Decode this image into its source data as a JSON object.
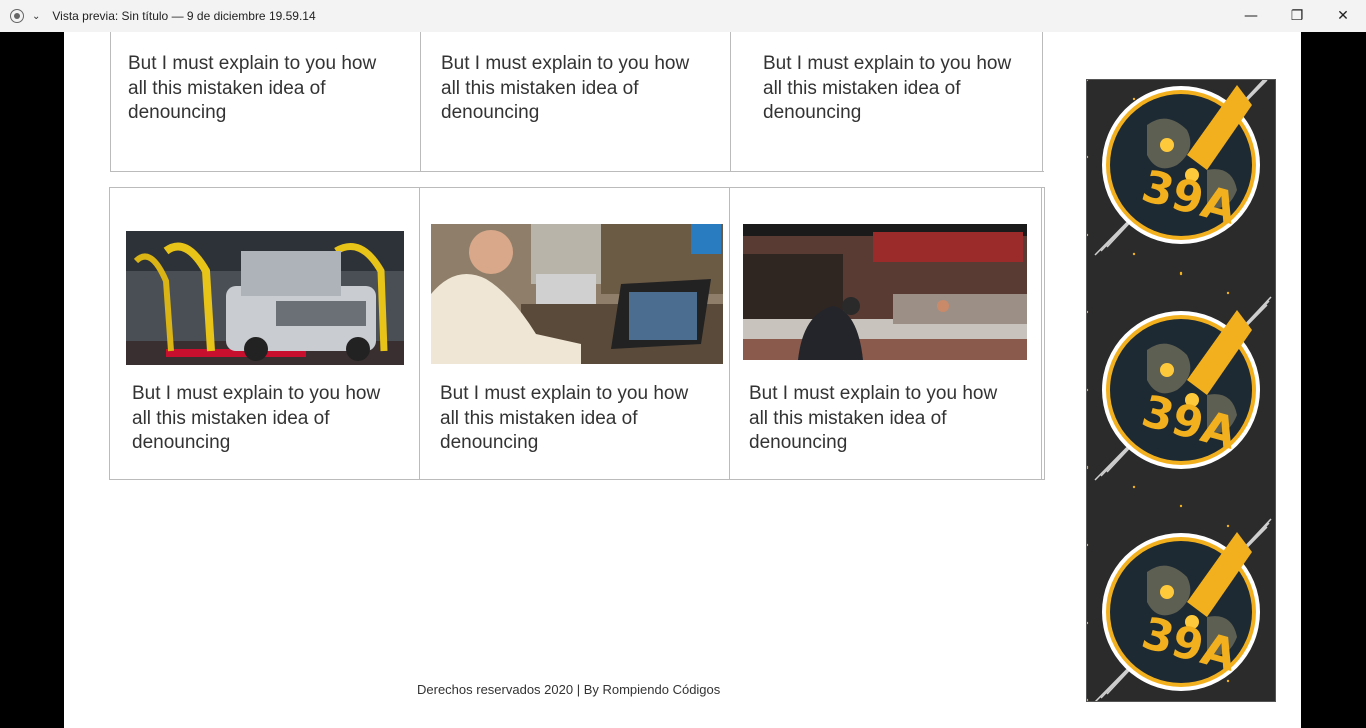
{
  "window": {
    "title": "Vista previa: Sin título — 9 de diciembre 19.59.14",
    "controls": {
      "minimize": "—",
      "restore": "❐",
      "close": "✕"
    }
  },
  "cards_top": [
    {
      "text": "But I must explain to you how all this mistaken idea of denouncing"
    },
    {
      "text": "But I must explain to you how all this mistaken idea of denouncing"
    },
    {
      "text": "But I must explain to you how all this mistaken idea of denouncing"
    }
  ],
  "cards_bottom": [
    {
      "text": "But I must explain to you how all this mistaken idea of denouncing",
      "image": "car-factory-photo"
    },
    {
      "text": "But I must explain to you how all this mistaken idea of denouncing",
      "image": "man-laptop-office-photo"
    },
    {
      "text": "But I must explain to you how all this mistaken idea of denouncing",
      "image": "butcher-shop-photo"
    }
  ],
  "ad": {
    "badge_text": "39A",
    "repeat": 3,
    "colors": {
      "bg": "#2b2b2b",
      "gold": "#f2b01e",
      "globe": "#1e2a33"
    }
  },
  "footer": {
    "text": "Derechos reservados 2020 | By Rompiendo Códigos"
  }
}
